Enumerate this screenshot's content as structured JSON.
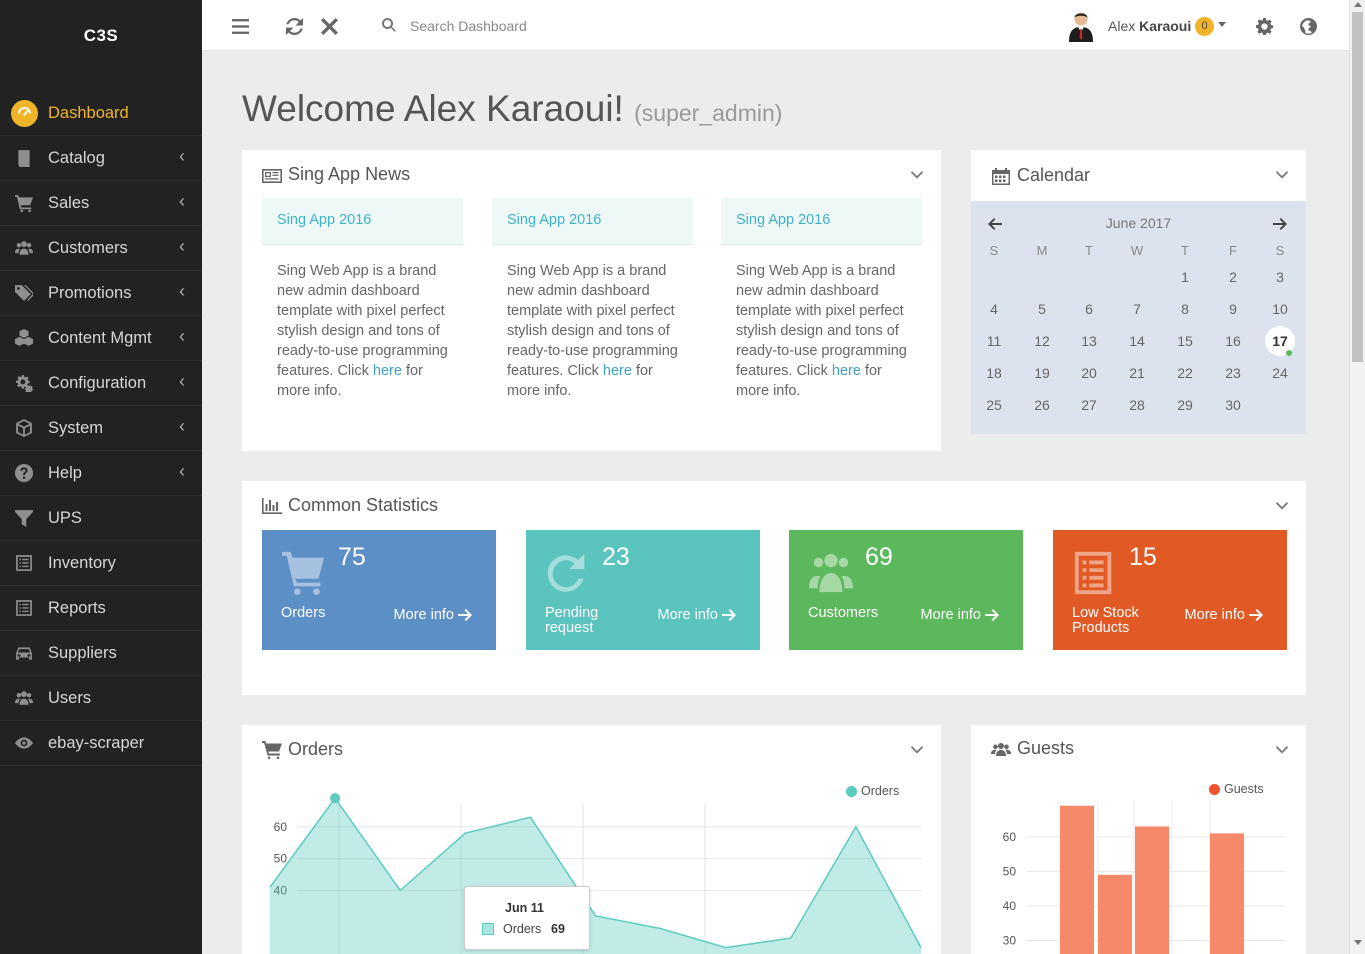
{
  "app": {
    "logo": "C3S"
  },
  "sidebar": {
    "items": [
      {
        "label": "Dashboard",
        "icon": "dashboard-icon"
      },
      {
        "label": "Catalog",
        "icon": "book-icon"
      },
      {
        "label": "Sales",
        "icon": "cart-icon"
      },
      {
        "label": "Customers",
        "icon": "users-icon"
      },
      {
        "label": "Promotions",
        "icon": "tags-icon"
      },
      {
        "label": "Content Mgmt",
        "icon": "cubes-icon"
      },
      {
        "label": "Configuration",
        "icon": "cogs-icon"
      },
      {
        "label": "System",
        "icon": "cube-icon"
      },
      {
        "label": "Help",
        "icon": "question-icon"
      },
      {
        "label": "UPS",
        "icon": "filter-icon"
      },
      {
        "label": "Inventory",
        "icon": "list-icon"
      },
      {
        "label": "Reports",
        "icon": "list-icon"
      },
      {
        "label": "Suppliers",
        "icon": "car-icon"
      },
      {
        "label": "Users",
        "icon": "users-icon"
      },
      {
        "label": "ebay-scraper",
        "icon": "eye-icon"
      }
    ]
  },
  "topbar": {
    "search_placeholder": "Search Dashboard",
    "user_first": "Alex",
    "user_last": "Karaoui",
    "notifications": "0"
  },
  "main": {
    "welcome": "Welcome Alex Karaoui!",
    "role": "(super_admin)"
  },
  "news": {
    "title": "Sing App News",
    "items": [
      {
        "title": "Sing App 2016",
        "body": "Sing Web App is a brand new admin dashboard template with pixel perfect stylish design and tons of ready-to-use programming features. Click ",
        "link": "here",
        "tail": " for more info."
      },
      {
        "title": "Sing App 2016",
        "body": "Sing Web App is a brand new admin dashboard template with pixel perfect stylish design and tons of ready-to-use programming features. Click ",
        "link": "here",
        "tail": " for more info."
      },
      {
        "title": "Sing App 2016",
        "body": "Sing Web App is a brand new admin dashboard template with pixel perfect stylish design and tons of ready-to-use programming features. Click ",
        "link": "here",
        "tail": " for more info."
      }
    ]
  },
  "calendar": {
    "title": "Calendar",
    "month": "June 2017",
    "weekdays": [
      "S",
      "M",
      "T",
      "W",
      "T",
      "F",
      "S"
    ],
    "first_weekday": 4,
    "days_in_month": 30,
    "today": 17
  },
  "stats": {
    "title": "Common Statistics",
    "more_label": "More info",
    "boxes": [
      {
        "value": "75",
        "label": "Orders",
        "color": "#5d8fc7",
        "icon": "cart-icon"
      },
      {
        "value": "23",
        "label": "Pending request",
        "color": "#5bc4bf",
        "icon": "refresh-icon"
      },
      {
        "value": "69",
        "label": "Customers",
        "color": "#5cb85c",
        "icon": "users-icon"
      },
      {
        "value": "15",
        "label": "Low Stock Products",
        "color": "#e15a25",
        "icon": "list-alt-icon"
      }
    ]
  },
  "orders_panel": {
    "title": "Orders"
  },
  "guests_panel": {
    "title": "Guests"
  },
  "chart_data": [
    {
      "type": "area",
      "title": "Orders",
      "series": [
        {
          "name": "Orders",
          "values": [
            41,
            69,
            40,
            58,
            63,
            32,
            28,
            22,
            25,
            60,
            22
          ]
        }
      ],
      "y_ticks": [
        40,
        50,
        60
      ],
      "ylim": [
        20,
        70
      ],
      "legend": "top-right",
      "grid": true,
      "color": "#5ccbc0",
      "tooltip": {
        "date": "Jun 11",
        "series": "Orders",
        "value": "69"
      }
    },
    {
      "type": "bar",
      "title": "Guests",
      "series": [
        {
          "name": "Guests",
          "values": [
            69,
            49,
            63,
            null,
            61
          ]
        }
      ],
      "y_ticks": [
        30,
        40,
        50,
        60
      ],
      "ylim": [
        20,
        75
      ],
      "legend": "top-right",
      "grid": true,
      "color": "#f5896a"
    }
  ]
}
